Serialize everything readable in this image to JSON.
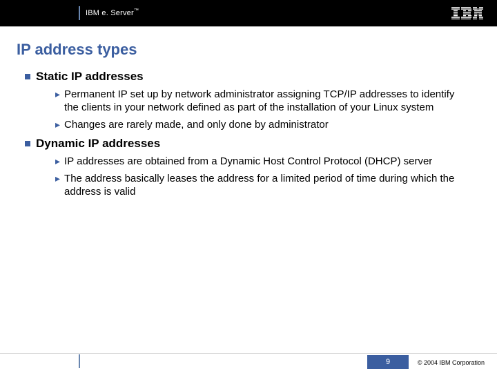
{
  "header": {
    "brand_html": "IBM e. Server™",
    "brand_text": "IBM e. Server",
    "brand_tm": "™"
  },
  "title": "IP address types",
  "sections": [
    {
      "heading": "Static IP addresses",
      "bullets": [
        "Permanent IP set up by network administrator assigning TCP/IP addresses to identify the clients in your network defined as part of the installation of your Linux system",
        "Changes are rarely made, and only done by administrator"
      ]
    },
    {
      "heading": "Dynamic IP addresses",
      "bullets": [
        "IP addresses are obtained from a Dynamic Host Control Protocol (DHCP) server",
        "The address basically leases the address for a limited period of time during which the address is valid"
      ]
    }
  ],
  "footer": {
    "page_number": "9",
    "copyright": "© 2004 IBM Corporation"
  }
}
